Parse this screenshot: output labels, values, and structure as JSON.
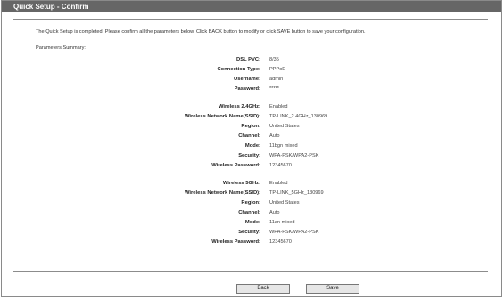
{
  "header": {
    "title": "Quick Setup - Confirm"
  },
  "intro": "The Quick Setup is completed. Please confirm all the parameters below. Click BACK button to modify or click SAVE button to save your configuration.",
  "summary_label": "Parameters Summary:",
  "rows": [
    {
      "label": "DSL PVC:",
      "value": "8/35"
    },
    {
      "label": "Connection Type:",
      "value": "PPPoE"
    },
    {
      "label": "Username:",
      "value": "admin"
    },
    {
      "label": "Password:",
      "value": "*****"
    },
    {
      "label": "Wireless 2.4GHz:",
      "value": "Enabled"
    },
    {
      "label": "Wireless Network Name(SSID):",
      "value": "TP-LINK_2.4GHz_130969"
    },
    {
      "label": "Region:",
      "value": "United States"
    },
    {
      "label": "Channel:",
      "value": "Auto"
    },
    {
      "label": "Mode:",
      "value": "11bgn mixed"
    },
    {
      "label": "Security:",
      "value": "WPA-PSK/WPA2-PSK"
    },
    {
      "label": "Wireless Password:",
      "value": "12345670"
    },
    {
      "label": "Wireless 5GHz:",
      "value": "Enabled"
    },
    {
      "label": "Wireless Network Name(SSID):",
      "value": "TP-LINK_5GHz_130969"
    },
    {
      "label": "Region:",
      "value": "United States"
    },
    {
      "label": "Channel:",
      "value": "Auto"
    },
    {
      "label": "Mode:",
      "value": "11an mixed"
    },
    {
      "label": "Security:",
      "value": "WPA-PSK/WPA2-PSK"
    },
    {
      "label": "Wireless Password:",
      "value": "12345670"
    }
  ],
  "buttons": {
    "back": "Back",
    "save": "Save"
  }
}
